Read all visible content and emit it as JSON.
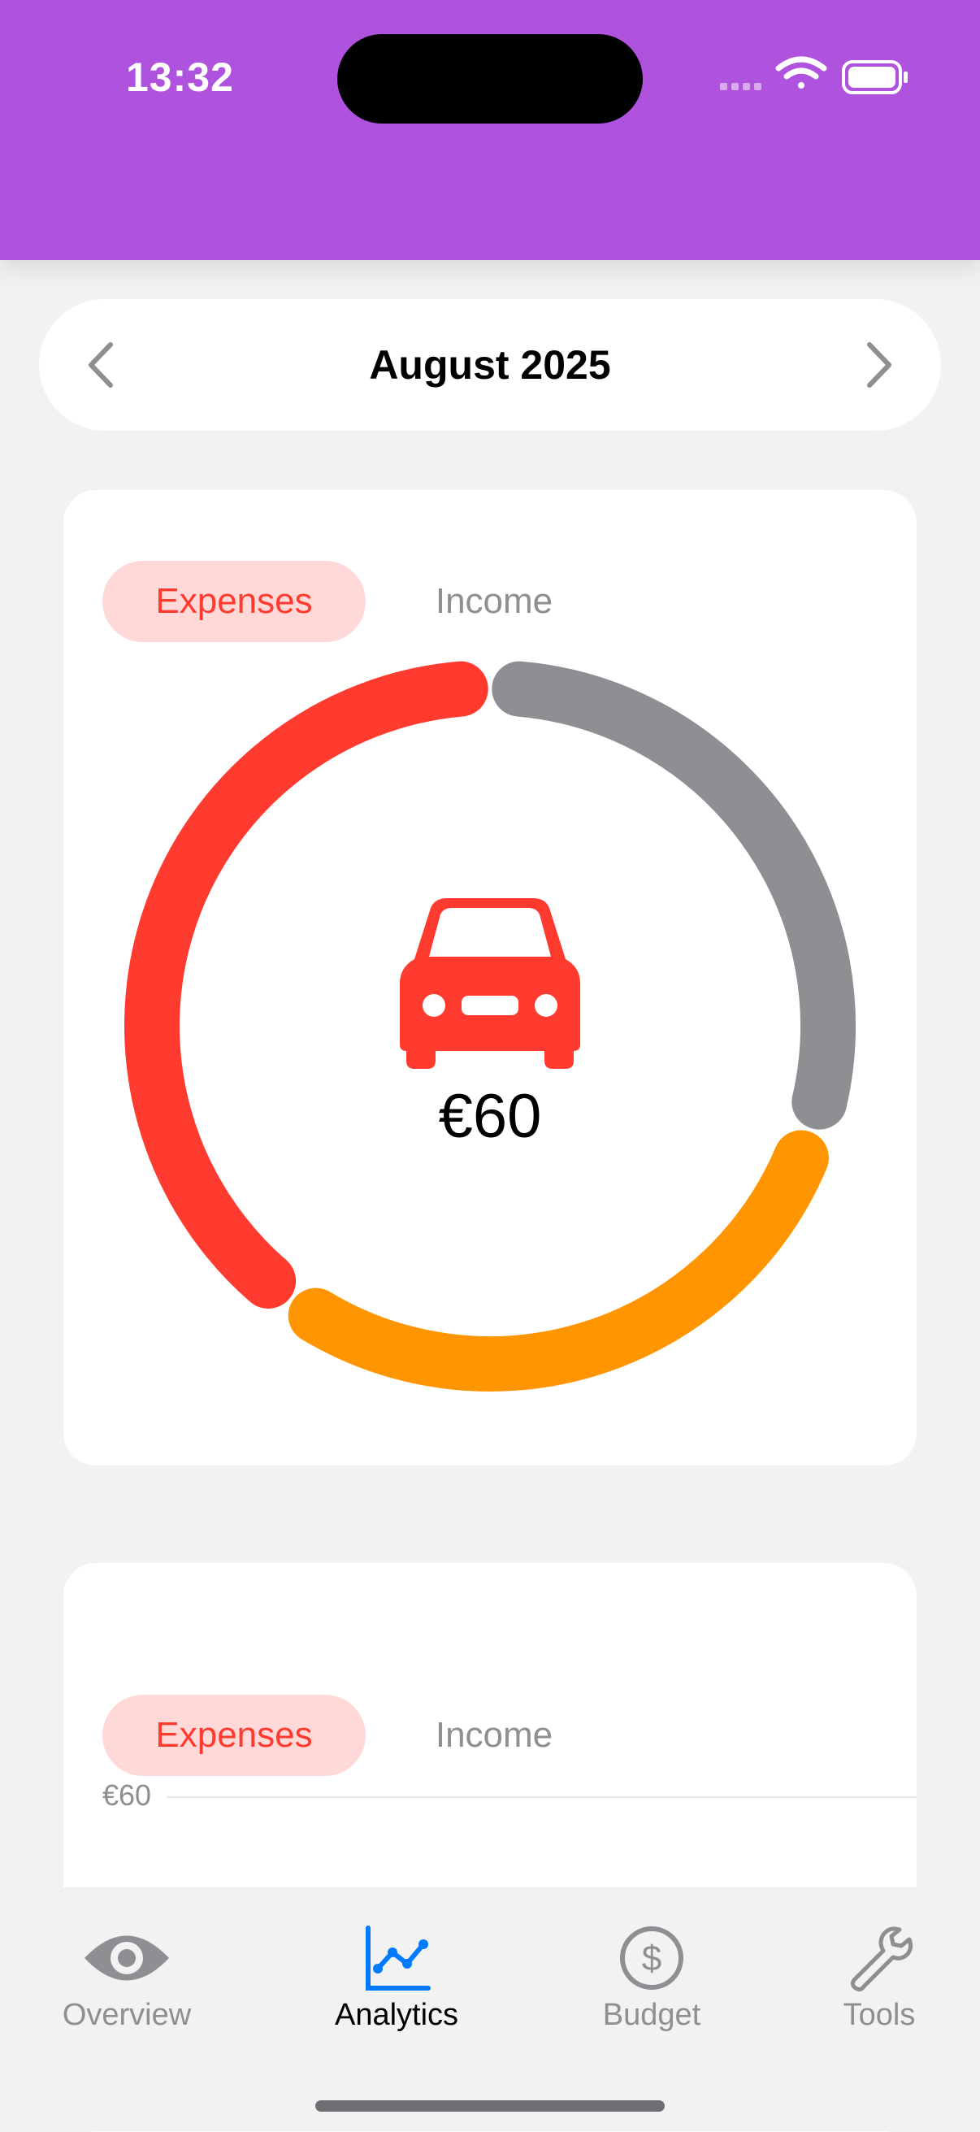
{
  "status_bar": {
    "time": "13:32",
    "background": "#af52de"
  },
  "header": {
    "month": "August 2025",
    "prev_icon": "chevron-left-icon",
    "next_icon": "chevron-right-icon"
  },
  "category_card": {
    "tabs": {
      "active": "Expenses",
      "inactive": "Income"
    },
    "center_icon": "car-icon",
    "amount": "€60",
    "segments": [
      {
        "color": "#ff3b30",
        "fraction": 0.4
      },
      {
        "color": "#ff9500",
        "fraction": 0.3
      },
      {
        "color": "#8e8e93",
        "fraction": 0.3
      }
    ]
  },
  "trend_card": {
    "tabs": {
      "active": "Expenses",
      "inactive": "Income"
    },
    "axis_label": "€60"
  },
  "tabbar": {
    "items": [
      {
        "label": "Overview",
        "icon": "eye-icon",
        "active": false
      },
      {
        "label": "Analytics",
        "icon": "chart-line-icon",
        "active": true
      },
      {
        "label": "Budget",
        "icon": "dollar-circle-icon",
        "active": false
      },
      {
        "label": "Tools",
        "icon": "wrench-icon",
        "active": false
      }
    ],
    "active_color": "#007aff",
    "inactive_color": "#8e8e93"
  }
}
